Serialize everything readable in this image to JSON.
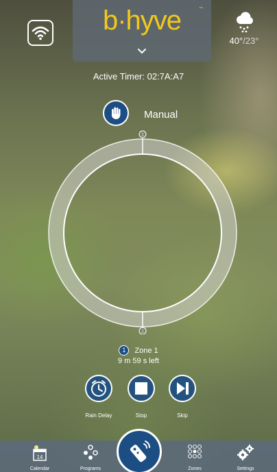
{
  "app": {
    "logo_text": "b·hyve",
    "logo_tm": "™",
    "brand_color": "#f2c81e",
    "accent_color": "#1c4d83"
  },
  "header": {
    "wifi_icon": "wifi-icon",
    "logo_menu_icon": "chevron-down-icon",
    "weather": {
      "icon": "snow-cloud-icon",
      "high": "40°",
      "low": "/23°"
    }
  },
  "timer": {
    "active_timer_text": "Active Timer: 02:7A:A7",
    "mode_label": "Manual",
    "mode_icon": "hand-icon",
    "ring_start_marker": "1",
    "ring_end_marker": "1"
  },
  "zone": {
    "number": "1",
    "name": "Zone 1",
    "time_left": "9 m 59 s left"
  },
  "controls": [
    {
      "label": "Rain Delay",
      "icon": "rain-delay-clock-icon"
    },
    {
      "label": "Stop",
      "icon": "stop-icon"
    },
    {
      "label": "Skip",
      "icon": "skip-icon"
    }
  ],
  "nav": {
    "items": [
      {
        "label": "Calendar",
        "icon": "calendar-icon",
        "calendar_day": "14"
      },
      {
        "label": "Programs",
        "icon": "programs-icon"
      },
      {
        "label": "",
        "icon": "remote-icon"
      },
      {
        "label": "Zones",
        "icon": "zones-grid-icon"
      },
      {
        "label": "Settings",
        "icon": "settings-gears-icon"
      }
    ]
  }
}
